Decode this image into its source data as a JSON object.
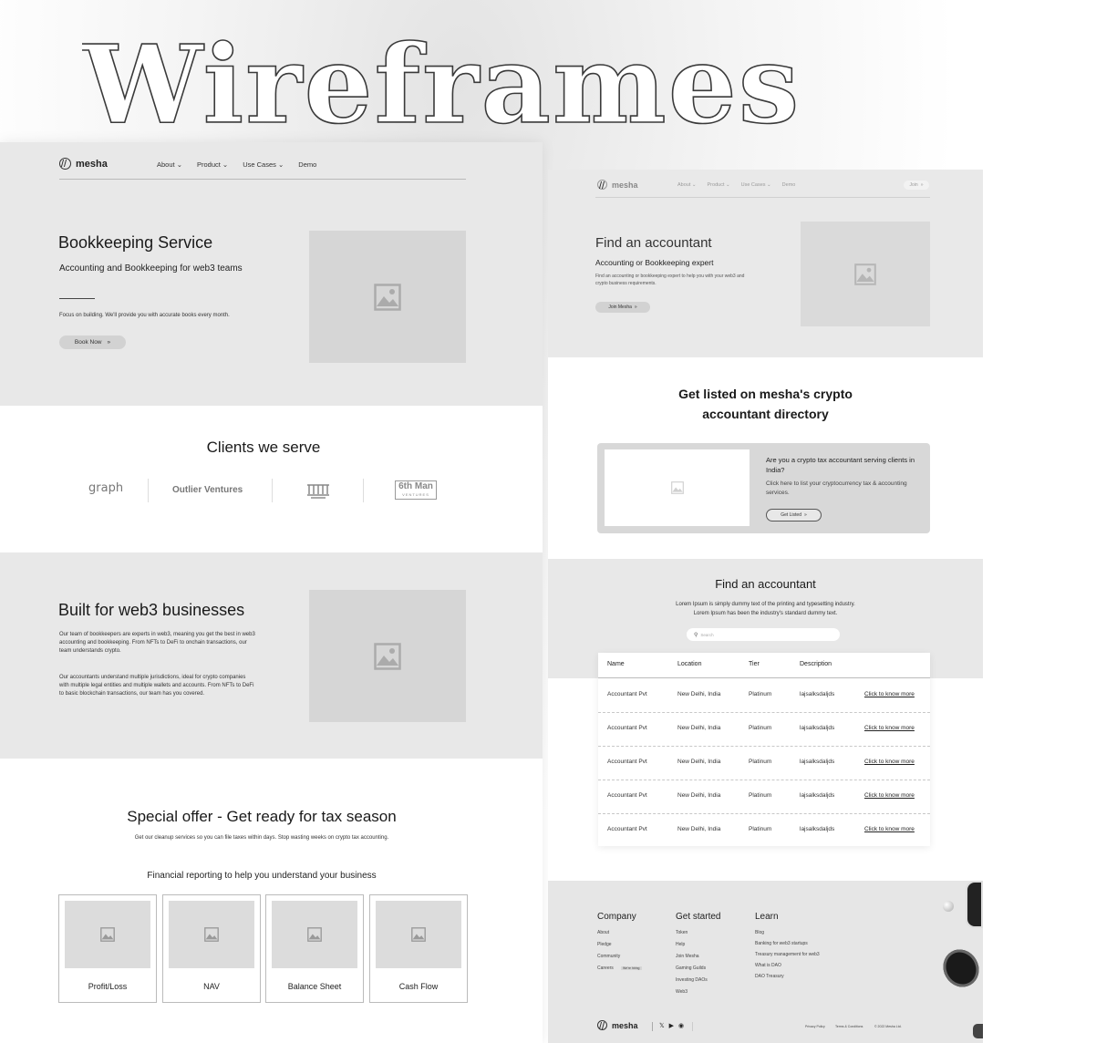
{
  "banner_title": "Wireframes",
  "left_page": {
    "nav": {
      "logo_text": "mesha",
      "links": [
        "About",
        "Product",
        "Use Cases",
        "Demo"
      ]
    },
    "hero": {
      "title": "Bookkeeping Service",
      "subtitle": "Accounting and Bookkeeping for web3 teams",
      "body": "Focus on building. We'll provide you with accurate books every month.",
      "cta": "Book Now"
    },
    "clients": {
      "title": "Clients we serve",
      "logos": [
        "graph",
        "Outlier Ventures",
        "6th Man"
      ],
      "logo_sub": "VENTURES"
    },
    "built": {
      "title": "Built for web3 businesses",
      "para1": "Our team of bookkeepers are experts in web3, meaning you get the best in web3 accounting and bookkeeping. From NFTs to DeFi to onchain transactions, our team understands crypto.",
      "para2": "Our accountants understand multiple jurisdictions, ideal for crypto companies with multiple legal entities and multiple wallets and accounts. From NFTs to DeFi to basic blockchain transactions, our team has you covered."
    },
    "offer": {
      "title": "Special offer - Get ready for tax season",
      "subtitle": "Get our cleanup services so you can file taxes within days. Stop wasting weeks on crypto tax accounting.",
      "reporting_title": "Financial reporting to help you understand your business",
      "cards": [
        "Profit/Loss",
        "NAV",
        "Balance Sheet",
        "Cash Flow"
      ]
    }
  },
  "right_page": {
    "nav": {
      "logo_text": "mesha",
      "links": [
        "About",
        "Product",
        "Use Cases",
        "Demo"
      ],
      "join": "Join"
    },
    "hero": {
      "title": "Find an accountant",
      "subtitle": "Accounting or Bookkeeping expert",
      "body": "Find an accounting or bookkeeping expert to help you with your web3 and crypto business requirements.",
      "cta": "Join Mesha"
    },
    "listed": {
      "title_line1": "Get listed on mesha's crypto",
      "title_line2": "accountant directory",
      "card_title": "Are you a crypto tax accountant serving clients in India?",
      "card_body": "Click here to list your cryptocurrency tax & accounting services.",
      "cta": "Get Listed"
    },
    "directory": {
      "title": "Find an accountant",
      "line1": "Lorem Ipsum is simply dummy text of the printing and typesetting industry.",
      "line2": "Lorem Ipsum has been the industry's standard dummy text.",
      "search_placeholder": "Search",
      "columns": [
        "Name",
        "Location",
        "Tier",
        "Description"
      ],
      "rows": [
        {
          "name": "Accountant Pvt",
          "location": "New Delhi, India",
          "tier": "Platinum",
          "description": "lajsalksdaljds",
          "link": "Click to know more"
        },
        {
          "name": "Accountant Pvt",
          "location": "New Delhi, India",
          "tier": "Platinum",
          "description": "lajsalksdaljds",
          "link": "Click to know more"
        },
        {
          "name": "Accountant Pvt",
          "location": "New Delhi, India",
          "tier": "Platinum",
          "description": "lajsalksdaljds",
          "link": "Click to know more"
        },
        {
          "name": "Accountant Pvt",
          "location": "New Delhi, India",
          "tier": "Platinum",
          "description": "lajsalksdaljds",
          "link": "Click to know more"
        },
        {
          "name": "Accountant Pvt",
          "location": "New Delhi, India",
          "tier": "Platinum",
          "description": "lajsalksdaljds",
          "link": "Click to know more"
        }
      ]
    },
    "footer": {
      "company": {
        "title": "Company",
        "links": [
          "About",
          "Pledge",
          "Community",
          "Careers"
        ],
        "hiring_badge": "We're hiring"
      },
      "get_started": {
        "title": "Get started",
        "links": [
          "Token",
          "Help",
          "Join Mesha",
          "Gaming Guilds",
          "Investing DAOs",
          "Web3"
        ]
      },
      "learn": {
        "title": "Learn",
        "links": [
          "Blog",
          "Banking for web3 startups",
          "Treasury management for web3",
          "What is DAO",
          "DAO Treasury"
        ]
      },
      "logo_text": "mesha",
      "legal": [
        "Privacy Policy",
        "Terms & Conditions",
        "© 2022 Mesha Ltd."
      ]
    }
  }
}
